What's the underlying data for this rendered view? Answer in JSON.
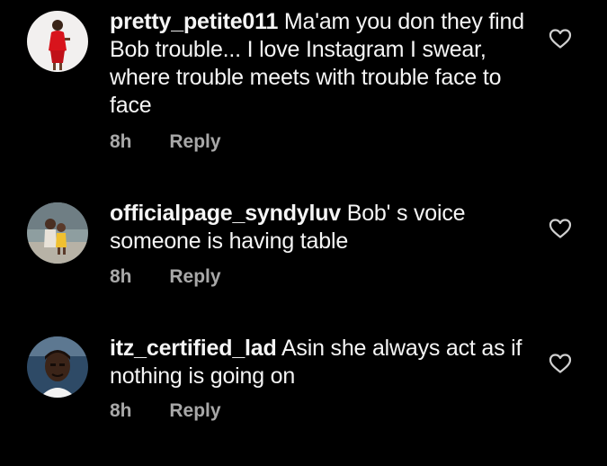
{
  "comments": [
    {
      "username": "pretty_petite011",
      "text": "Ma'am you don they find Bob trouble... I love Instagram I swear, where trouble meets with trouble face to face",
      "time": "8h",
      "reply_label": "Reply",
      "avatar_icon": "avatar-woman-red-dress"
    },
    {
      "username": "officialpage_syndyluv",
      "text": "Bob' s voice someone is having table",
      "time": "8h",
      "reply_label": "Reply",
      "avatar_icon": "avatar-child-photo"
    },
    {
      "username": "itz_certified_lad",
      "text": "Asin she always act as if nothing is going on",
      "time": "8h",
      "reply_label": "Reply",
      "avatar_icon": "avatar-man-portrait"
    }
  ],
  "icons": {
    "like": "heart-outline-icon"
  },
  "colors": {
    "background": "#000000",
    "text": "#f5f5f5",
    "meta": "#a8a8a8"
  }
}
